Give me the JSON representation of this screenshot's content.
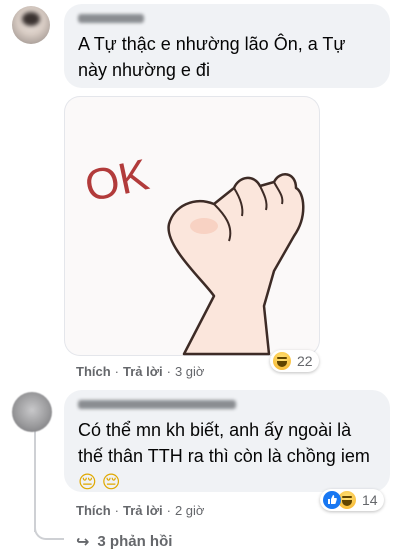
{
  "comment1": {
    "text": "A Tự thậc e nhường lão Ôn, a Tự này nhường e đi",
    "sticker": {
      "label": "OK"
    },
    "actions": {
      "like": "Thích",
      "reply": "Trả lời",
      "time": "3 giờ"
    },
    "reactions": {
      "icons": [
        "haha-icon"
      ],
      "count": "22"
    }
  },
  "comment2": {
    "text": "Có thể mn kh biết, anh ấy ngoài là thế thân TTH ra thì còn là chồng iem",
    "emojis": [
      "😔",
      "😔"
    ],
    "actions": {
      "like": "Thích",
      "reply": "Trả lời",
      "time": "2 giờ"
    },
    "reactions": {
      "icons": [
        "like-icon",
        "haha-icon"
      ],
      "count": "14"
    }
  },
  "replies": {
    "label": "3 phản hồi"
  },
  "colors": {
    "bubble": "#f0f2f5",
    "secondary_text": "#65676b",
    "like_blue": "#1877f2",
    "haha_yellow": "#f7b125"
  }
}
